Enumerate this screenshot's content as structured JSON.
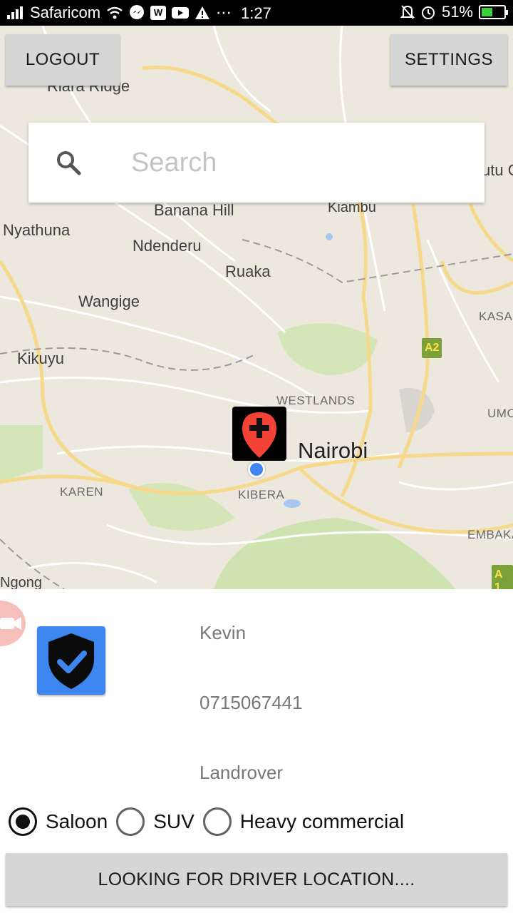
{
  "status_bar": {
    "carrier": "Safaricom",
    "time": "1:27",
    "battery_percent": "51%",
    "battery_level": 0.51,
    "notification_box": "W",
    "overflow": "⋯"
  },
  "map": {
    "logout_label": "LOGOUT",
    "settings_label": "SETTINGS",
    "search_placeholder": "Search",
    "labels": {
      "riara": "Riara Ridge",
      "banana": "Banana Hill",
      "kiambu": "Kiambu",
      "nyathuna": "Nyathuna",
      "ndenderu": "Ndenderu",
      "ruaka": "Ruaka",
      "wangige": "Wangige",
      "kikuyu": "Kikuyu",
      "westlands": "WESTLANDS",
      "nairobi": "Nairobi",
      "karen": "KAREN",
      "kibera": "KIBERA",
      "kasa": "KASA",
      "umo": "UMO",
      "embaka": "EMBAKA",
      "ngong": "Ngong",
      "rutu": "utu C",
      "a2": "A2",
      "a1": "A 1"
    }
  },
  "panel": {
    "name": "Kevin",
    "phone": "0715067441",
    "vehicle": "Landrover",
    "vehicle_types": [
      {
        "label": "Saloon",
        "checked": true
      },
      {
        "label": "SUV",
        "checked": false
      },
      {
        "label": "Heavy commercial",
        "checked": false
      }
    ],
    "action_label": "LOOKING FOR DRIVER LOCATION...."
  },
  "colors": {
    "map_bg": "#ece8de",
    "park": "#cfe3b0",
    "road_major": "#f6d98a",
    "road_minor": "#ffffff",
    "marker_red": "#f44336",
    "location_blue": "#4285f4",
    "shield_blue": "#3d86f0",
    "button_gray": "#d6d6d6"
  }
}
